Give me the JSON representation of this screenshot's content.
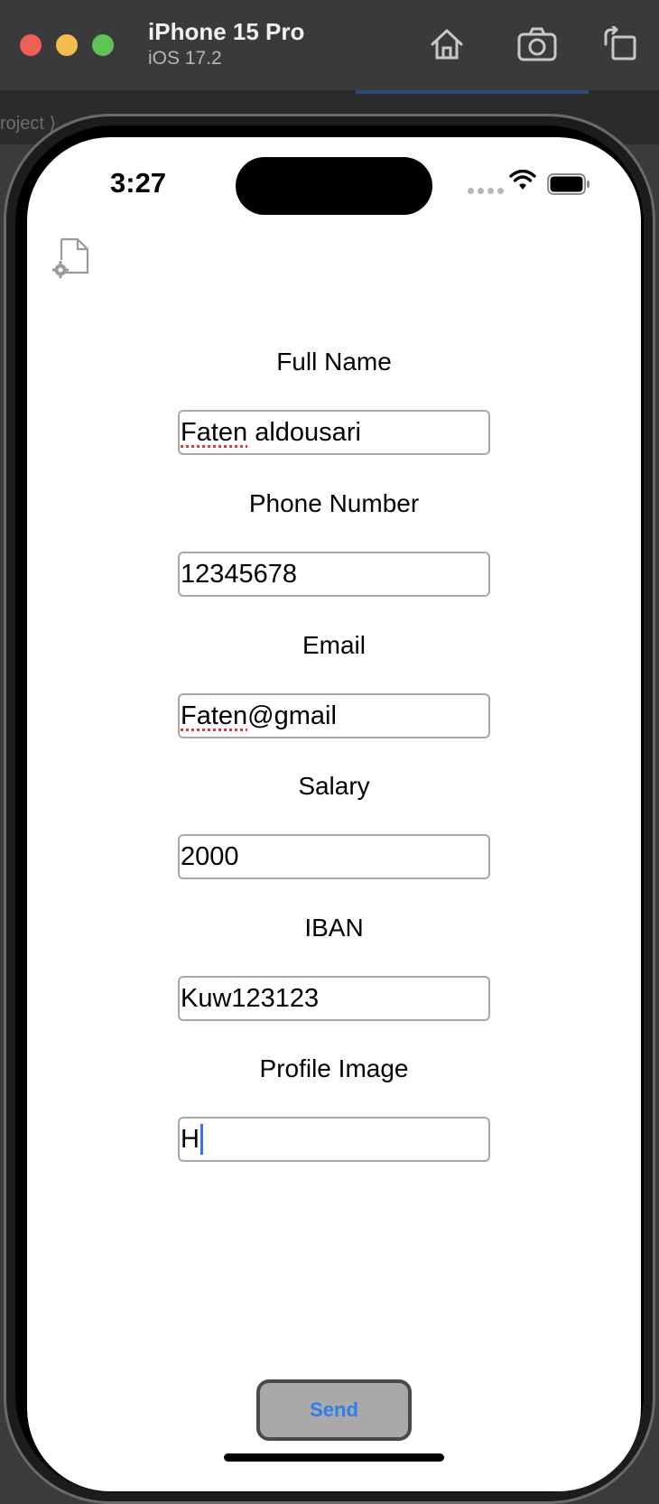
{
  "simulator": {
    "device_name": "iPhone 15 Pro",
    "os_version": "iOS 17.2",
    "breadcrumb": "roject ⟩ "
  },
  "status_bar": {
    "time": "3:27"
  },
  "form": {
    "fields": [
      {
        "label": "Full Name",
        "value_first": "Faten",
        "value_rest": " aldousari"
      },
      {
        "label": "Phone Number",
        "value_first": "",
        "value_rest": "12345678"
      },
      {
        "label": "Email",
        "value_first": "Faten",
        "value_rest": "@gmail"
      },
      {
        "label": "Salary",
        "value_first": "",
        "value_rest": "2000"
      },
      {
        "label": "IBAN",
        "value_first": "",
        "value_rest": "Kuw123123"
      },
      {
        "label": "Profile Image",
        "value_first": "",
        "value_rest": "H"
      }
    ],
    "send_label": "Send"
  },
  "colors": {
    "send_text": "#2f7bf0",
    "caret": "#3a6ff5",
    "spellcheck": "#e03a3a"
  },
  "icons": {
    "toolbar": [
      "home-icon",
      "camera-icon",
      "rotate-icon"
    ],
    "status": [
      "signal-dots-icon",
      "wifi-icon",
      "battery-icon"
    ],
    "app": "file-gear-icon"
  }
}
